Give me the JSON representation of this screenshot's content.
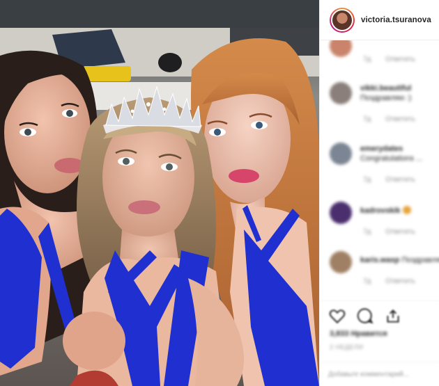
{
  "header": {
    "username": "victoria.tsuranova",
    "avatar_icon": "profile-avatar"
  },
  "comments": [
    {
      "username": "",
      "text": "",
      "time": "7д",
      "reply": "Ответить",
      "avatar_color": "#c9846b"
    },
    {
      "username": "vikki.beautiful",
      "text": "Поздравляю :)",
      "time": "7д",
      "reply": "Ответить",
      "avatar_color": "#8a7f7a"
    },
    {
      "username": "emerydates",
      "text": "Congratulations ...",
      "time": "7д",
      "reply": "Ответить",
      "avatar_color": "#7b8593"
    },
    {
      "username": "kadrovskik",
      "text": "",
      "time": "7д",
      "reply": "Ответить",
      "avatar_color": "#4a2e6e"
    },
    {
      "username": "karis.wasp",
      "text": "Поздравляю",
      "time": "7д",
      "reply": "Ответить",
      "avatar_color": "#a08064"
    }
  ],
  "actions": {
    "like_icon": "heart-icon",
    "comment_icon": "comment-icon",
    "share_icon": "share-icon"
  },
  "likes": "3,833 Нравится",
  "date": "2 НЕДЕЛИ",
  "add_comment_placeholder": "Добавьте комментарий...",
  "colors": {
    "dress": "#1f2fd0",
    "border": "#efefef",
    "muted": "#8e8e8e",
    "text": "#262626"
  }
}
